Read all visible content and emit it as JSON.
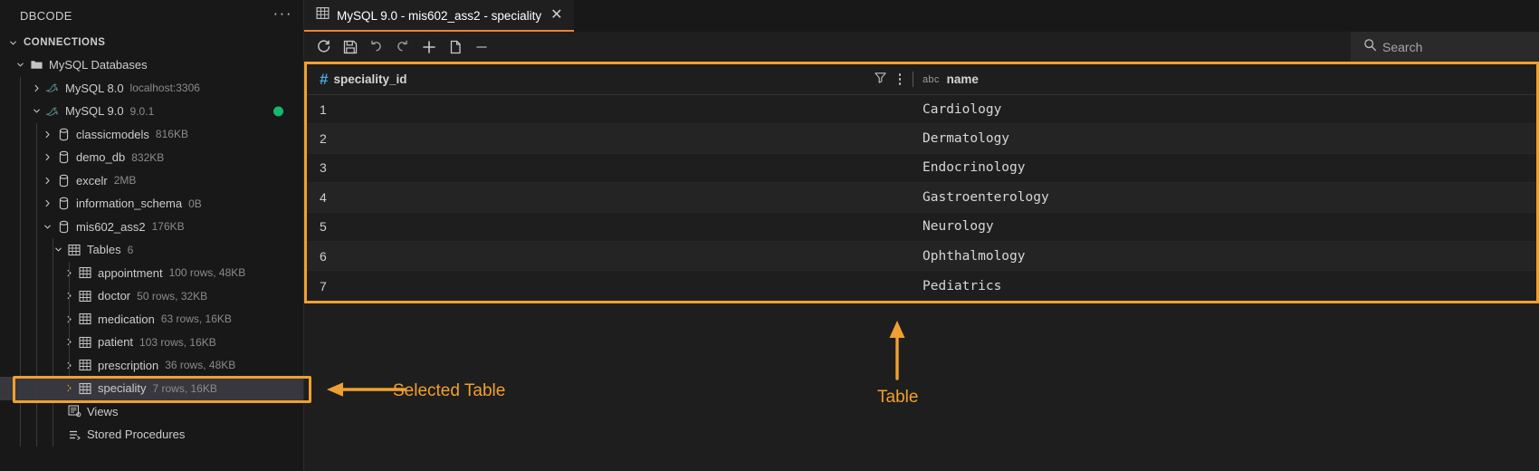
{
  "sidebar": {
    "title": "DBCODE",
    "more_actions": "···",
    "section_label": "CONNECTIONS",
    "folder": {
      "label": "MySQL Databases"
    },
    "connections": [
      {
        "label": "MySQL 8.0",
        "meta": "localhost:3306",
        "expanded": false,
        "online": false
      },
      {
        "label": "MySQL 9.0",
        "meta": "9.0.1",
        "expanded": true,
        "online": true
      }
    ],
    "databases": [
      {
        "label": "classicmodels",
        "meta": "816KB",
        "expanded": false
      },
      {
        "label": "demo_db",
        "meta": "832KB",
        "expanded": false
      },
      {
        "label": "excelr",
        "meta": "2MB",
        "expanded": false
      },
      {
        "label": "information_schema",
        "meta": "0B",
        "expanded": false
      },
      {
        "label": "mis602_ass2",
        "meta": "176KB",
        "expanded": true
      }
    ],
    "tables_group": {
      "label": "Tables",
      "meta": "6"
    },
    "tables": [
      {
        "label": "appointment",
        "meta": "100 rows, 48KB",
        "selected": false
      },
      {
        "label": "doctor",
        "meta": "50 rows, 32KB",
        "selected": false
      },
      {
        "label": "medication",
        "meta": "63 rows, 16KB",
        "selected": false
      },
      {
        "label": "patient",
        "meta": "103 rows, 16KB",
        "selected": false
      },
      {
        "label": "prescription",
        "meta": "36 rows, 48KB",
        "selected": false
      },
      {
        "label": "speciality",
        "meta": "7 rows, 16KB",
        "selected": true
      }
    ],
    "views": {
      "label": "Views"
    },
    "stored_procedures": {
      "label": "Stored Procedures"
    }
  },
  "tab": {
    "label": "MySQL 9.0 - mis602_ass2 - speciality",
    "close": "✕"
  },
  "toolbar": {
    "buttons": [
      {
        "name": "refresh-button",
        "title": "Refresh"
      },
      {
        "name": "save-button",
        "title": "Save"
      },
      {
        "name": "undo-button",
        "title": "Undo"
      },
      {
        "name": "redo-button",
        "title": "Redo"
      },
      {
        "name": "add-row-button",
        "title": "Add row"
      },
      {
        "name": "duplicate-row-button",
        "title": "Duplicate row"
      },
      {
        "name": "delete-row-button",
        "title": "Delete row"
      }
    ]
  },
  "search": {
    "placeholder": "Search",
    "value": ""
  },
  "grid": {
    "columns": [
      {
        "name": "speciality_id",
        "type_icon": "#",
        "type": "number"
      },
      {
        "name": "name",
        "type_icon": "abc",
        "type": "text"
      }
    ],
    "rows": [
      {
        "speciality_id": "1",
        "name": "Cardiology"
      },
      {
        "speciality_id": "2",
        "name": "Dermatology"
      },
      {
        "speciality_id": "3",
        "name": "Endocrinology"
      },
      {
        "speciality_id": "4",
        "name": "Gastroenterology"
      },
      {
        "speciality_id": "5",
        "name": "Neurology"
      },
      {
        "speciality_id": "6",
        "name": "Ophthalmology"
      },
      {
        "speciality_id": "7",
        "name": "Pediatrics"
      }
    ]
  },
  "annotations": [
    {
      "label": "Selected Table",
      "arrow": "left"
    },
    {
      "label": "Table",
      "arrow": "up"
    }
  ],
  "colors": {
    "accent": "#f0a030",
    "tab_underline": "#e8833a",
    "status_online": "#15b76c",
    "numeric_type": "#4aa3e0"
  }
}
